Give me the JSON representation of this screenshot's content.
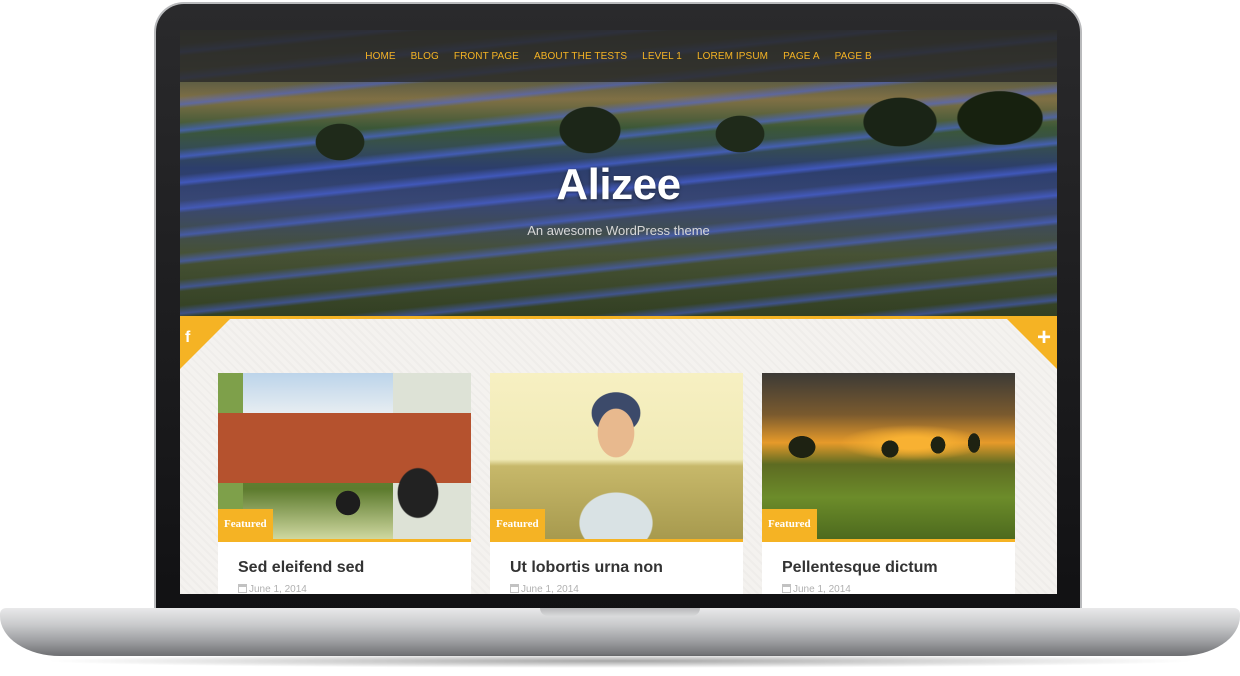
{
  "nav": {
    "items": [
      "HOME",
      "BLOG",
      "FRONT PAGE",
      "ABOUT THE TESTS",
      "LEVEL 1",
      "LOREM IPSUM",
      "PAGE A",
      "PAGE B"
    ]
  },
  "header": {
    "title": "Alizee",
    "tagline": "An awesome WordPress theme"
  },
  "social": {
    "left_icon": "f",
    "right_icon": "+"
  },
  "posts": [
    {
      "badge": "Featured",
      "title": "Sed eleifend sed",
      "date": "June 1, 2014",
      "image": "tractor-image"
    },
    {
      "badge": "Featured",
      "title": "Ut lobortis urna non",
      "date": "June 1, 2014",
      "image": "woman-field-image"
    },
    {
      "badge": "Featured",
      "title": "Pellentesque dictum",
      "date": "June 1, 2014",
      "image": "sunset-field-image"
    }
  ],
  "colors": {
    "accent": "#f5b324",
    "nav_bg": "#2a2a28",
    "title": "#ffffff",
    "post_title": "#333333"
  }
}
